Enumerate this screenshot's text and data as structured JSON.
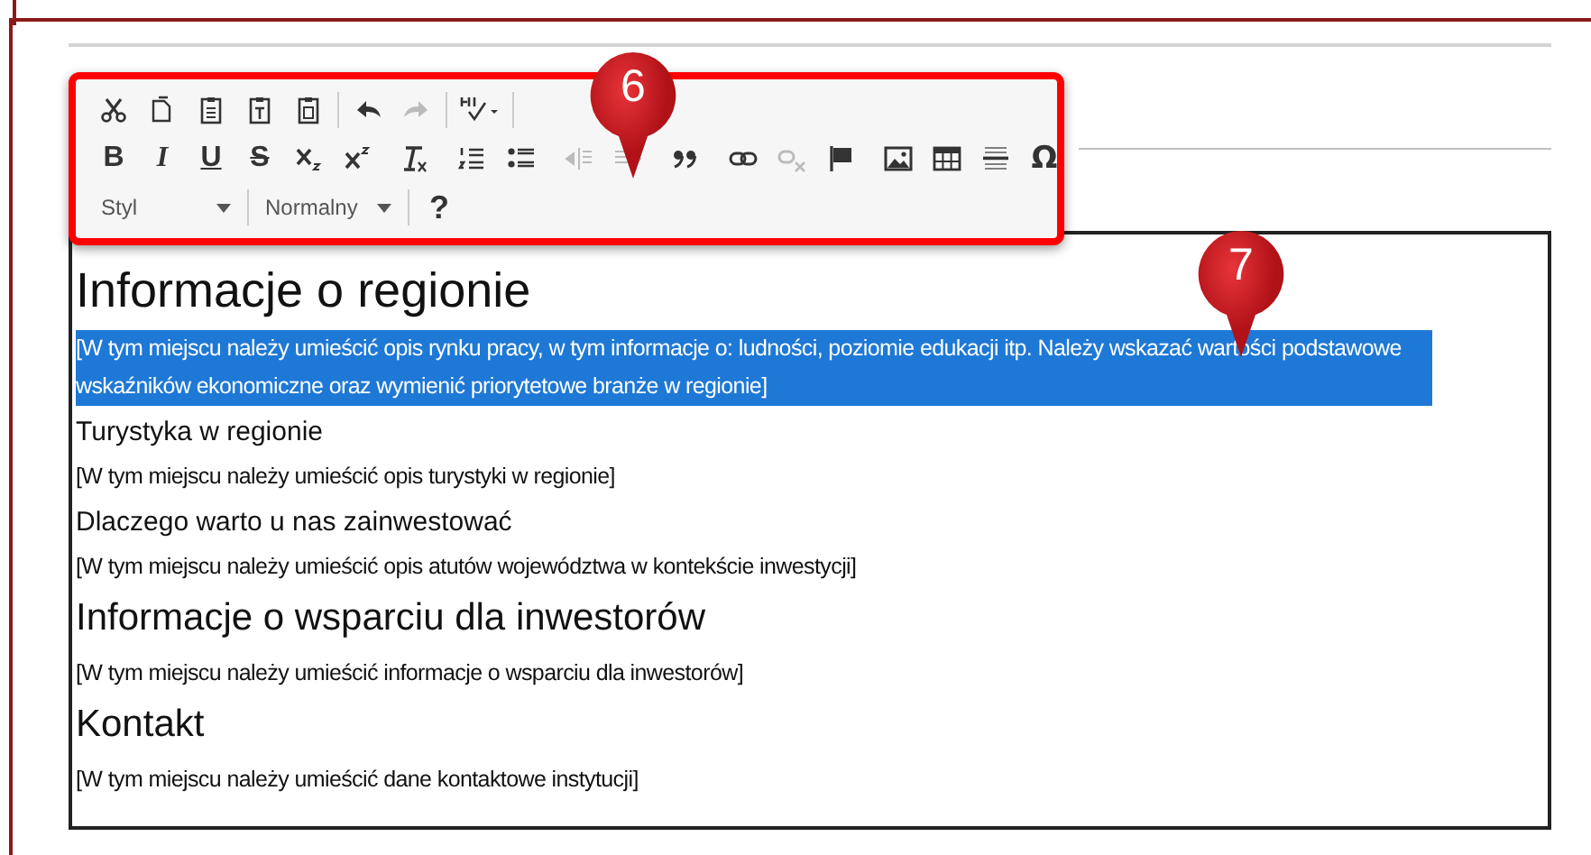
{
  "toolbar": {
    "rows": [
      [
        {
          "kind": "cut",
          "disabled": false
        },
        {
          "kind": "copy",
          "disabled": false
        },
        {
          "kind": "paste",
          "disabled": false
        },
        {
          "kind": "paste-text",
          "disabled": false
        },
        {
          "kind": "paste-word",
          "disabled": false
        },
        {
          "kind": "sep"
        },
        {
          "kind": "undo",
          "disabled": false
        },
        {
          "kind": "redo",
          "disabled": true
        },
        {
          "kind": "sep"
        },
        {
          "kind": "spellcheck",
          "disabled": false
        },
        {
          "kind": "sep"
        }
      ],
      [
        {
          "kind": "bold",
          "label": "B",
          "disabled": false
        },
        {
          "kind": "italic",
          "label": "I",
          "disabled": false
        },
        {
          "kind": "underline",
          "label": "U",
          "disabled": false
        },
        {
          "kind": "strike",
          "label": "S",
          "disabled": false
        },
        {
          "kind": "subscript",
          "disabled": false
        },
        {
          "kind": "superscript",
          "disabled": false
        },
        {
          "kind": "sep"
        },
        {
          "kind": "remove-format",
          "disabled": false
        },
        {
          "kind": "sep"
        },
        {
          "kind": "numbered-list",
          "disabled": false
        },
        {
          "kind": "bullet-list",
          "disabled": false
        },
        {
          "kind": "sep"
        },
        {
          "kind": "outdent",
          "disabled": true
        },
        {
          "kind": "indent",
          "disabled": true
        },
        {
          "kind": "sep"
        },
        {
          "kind": "quote",
          "disabled": false
        },
        {
          "kind": "sep"
        },
        {
          "kind": "link",
          "disabled": false
        },
        {
          "kind": "unlink",
          "disabled": true
        },
        {
          "kind": "anchor",
          "disabled": false
        },
        {
          "kind": "sep"
        },
        {
          "kind": "image",
          "disabled": false
        },
        {
          "kind": "table",
          "disabled": false
        },
        {
          "kind": "hrule",
          "disabled": false
        },
        {
          "kind": "symbol",
          "label": "Ω",
          "disabled": false
        }
      ]
    ],
    "style_dropdown": "Styl",
    "format_dropdown": "Normalny",
    "help": "?"
  },
  "markers": [
    "6",
    "7"
  ],
  "content": [
    {
      "kind": "h1",
      "text": "Informacje o regionie",
      "selected": false
    },
    {
      "kind": "p",
      "text": "[W tym miejscu należy umieścić opis rynku pracy, w tym informacje o: ludności, poziomie edukacji itp. Należy wskazać wartości podstawowe wskaźników ekonomiczne oraz wymienić priorytetowe branże w regionie]",
      "selected": true
    },
    {
      "kind": "h3",
      "text": "Turystyka w regionie",
      "selected": false
    },
    {
      "kind": "p",
      "text": "[W tym miejscu należy umieścić opis turystyki w regionie]",
      "selected": false
    },
    {
      "kind": "h3",
      "text": "Dlaczego warto u nas zainwestować",
      "selected": false
    },
    {
      "kind": "p",
      "text": "[W tym miejscu należy umieścić opis atutów województwa w kontekście inwestycji]",
      "selected": false
    },
    {
      "kind": "h2",
      "text": "Informacje o wsparciu dla inwestorów",
      "selected": false
    },
    {
      "kind": "p",
      "text": "[W tym miejscu należy umieścić informacje o wsparciu dla inwestorów]",
      "selected": false
    },
    {
      "kind": "h2",
      "text": "Kontakt",
      "selected": false
    },
    {
      "kind": "p",
      "text": "[W tym miejscu należy umieścić dane kontaktowe instytucji]",
      "selected": false
    }
  ]
}
